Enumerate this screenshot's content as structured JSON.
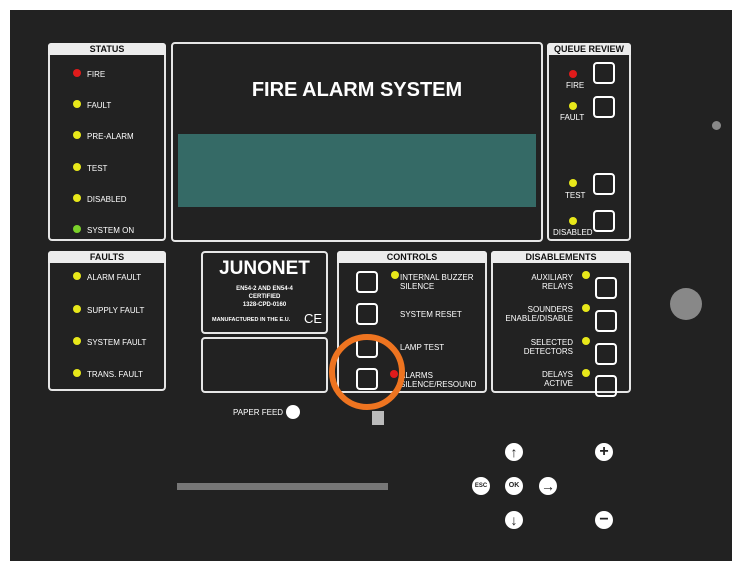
{
  "colors": {
    "red": "#e01b1b",
    "yellow": "#e8e81a",
    "green": "#7bd12a",
    "orange": "#ee7420",
    "screen": "#356a66",
    "panel": "#222222"
  },
  "status": {
    "header": "STATUS",
    "items": [
      {
        "label": "FIRE",
        "led": "red"
      },
      {
        "label": "FAULT",
        "led": "yellow"
      },
      {
        "label": "PRE-ALARM",
        "led": "yellow"
      },
      {
        "label": "TEST",
        "led": "yellow"
      },
      {
        "label": "DISABLED",
        "led": "yellow"
      },
      {
        "label": "SYSTEM ON",
        "led": "green"
      }
    ]
  },
  "display": {
    "title": "FIRE ALARM SYSTEM"
  },
  "queue_review": {
    "header": "QUEUE REVIEW",
    "items": [
      {
        "label": "FIRE",
        "led": "red"
      },
      {
        "label": "FAULT",
        "led": "yellow"
      },
      {
        "label": "TEST",
        "led": "yellow"
      },
      {
        "label": "DISABLED",
        "led": "yellow"
      }
    ]
  },
  "faults": {
    "header": "FAULTS",
    "items": [
      {
        "label": "ALARM FAULT"
      },
      {
        "label": "SUPPLY FAULT"
      },
      {
        "label": "SYSTEM FAULT"
      },
      {
        "label": "TRANS. FAULT"
      }
    ]
  },
  "brand": {
    "logo": "JUNONET",
    "cert_line1": "EN54-2 AND EN54-4",
    "cert_line2": "CERTIFIED",
    "cert_line3": "1328-CPD-0160",
    "made": "MANUFACTURED IN THE E.U.",
    "ce": "CE"
  },
  "controls": {
    "header": "CONTROLS",
    "buzzer": "INTERNAL BUZZER SILENCE",
    "buzzer1": "INTERNAL BUZZER",
    "buzzer2": "SILENCE",
    "reset": "SYSTEM RESET",
    "lamp": "LAMP TEST",
    "alarms1": "ALARMS",
    "alarms2": "SILENCE/RESOUND"
  },
  "disablements": {
    "header": "DISABLEMENTS",
    "aux1": "AUXILIARY",
    "aux2": "RELAYS",
    "snd1": "SOUNDERS",
    "snd2": "ENABLE/DISABLE",
    "det1": "SELECTED",
    "det2": "DETECTORS",
    "del1": "DELAYS",
    "del2": "ACTIVE"
  },
  "printer": {
    "paper_feed": "PAPER FEED"
  },
  "nav": {
    "up": "↑",
    "down": "↓",
    "right": "→",
    "ok": "OK",
    "esc": "ESC",
    "plus": "+",
    "minus": "−"
  }
}
